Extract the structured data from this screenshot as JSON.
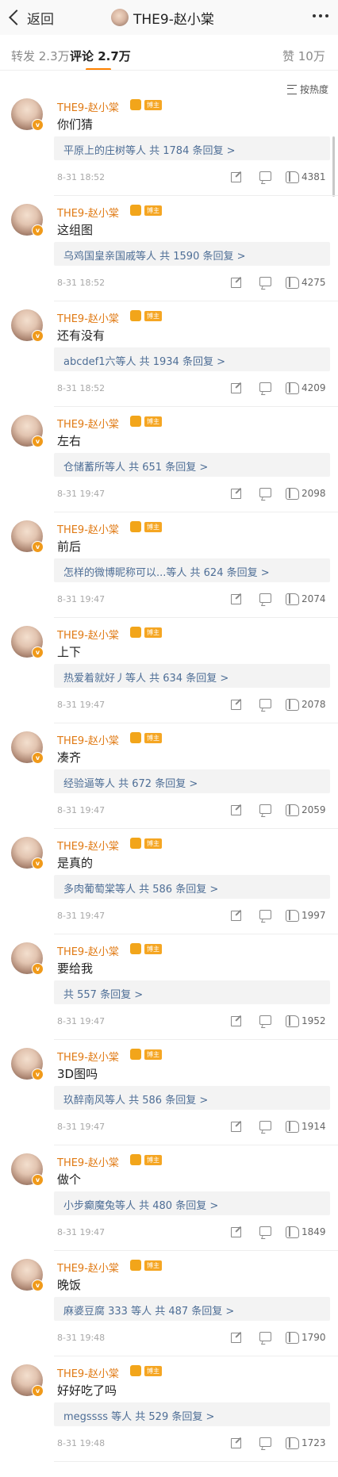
{
  "header": {
    "back_label": "返回",
    "title": "THE9-赵小棠"
  },
  "tabs": [
    {
      "label": "转发 2.3万"
    },
    {
      "label": "评论 2.7万"
    },
    {
      "label": "赞 10万"
    }
  ],
  "sort_label": "按热度",
  "accent_color": "#ff8200",
  "username": "THE9-赵小棠",
  "badge_text": "博主",
  "comments": [
    {
      "text": "你们猜",
      "reply": "平原上的庄树等人  共 1784 条回复 >",
      "time": "8-31 18:52",
      "likes": "4381"
    },
    {
      "text": "这组图",
      "reply": "乌鸡国皇亲国戚等人  共 1590 条回复 >",
      "time": "8-31 18:52",
      "likes": "4275"
    },
    {
      "text": "还有没有",
      "reply": "abcdef1六等人  共 1934 条回复 >",
      "time": "8-31 18:52",
      "likes": "4209"
    },
    {
      "text": "左右",
      "reply": "仓储蓄所等人  共 651 条回复 >",
      "time": "8-31 19:47",
      "likes": "2098"
    },
    {
      "text": "前后",
      "reply": "怎样的微博昵称可以...等人  共 624 条回复 >",
      "time": "8-31 19:47",
      "likes": "2074"
    },
    {
      "text": "上下",
      "reply": "热爱着就好丿等人  共 634 条回复 >",
      "time": "8-31 19:47",
      "likes": "2078"
    },
    {
      "text": "凑齐",
      "reply": "经验逼等人  共 672 条回复 >",
      "time": "8-31 19:47",
      "likes": "2059"
    },
    {
      "text": "是真的",
      "reply": "多肉葡萄棠等人  共 586 条回复 >",
      "time": "8-31 19:47",
      "likes": "1997"
    },
    {
      "text": "要给我",
      "reply": "共 557 条回复 >",
      "time": "8-31 19:47",
      "likes": "1952"
    },
    {
      "text": "3D图吗",
      "reply": "玖醉南风等人  共 586 条回复 >",
      "time": "8-31 19:47",
      "likes": "1914"
    },
    {
      "text": "做个",
      "reply": "小步癫魔兔等人  共 480 条回复 >",
      "time": "8-31 19:47",
      "likes": "1849"
    },
    {
      "text": "晚饭",
      "reply": "麻婆豆腐 333 等人  共 487 条回复 >",
      "time": "8-31 19:48",
      "likes": "1790"
    },
    {
      "text": "好好吃了吗",
      "reply": "megssss 等人  共 529 条回复 >",
      "time": "8-31 19:48",
      "likes": "1723"
    }
  ]
}
